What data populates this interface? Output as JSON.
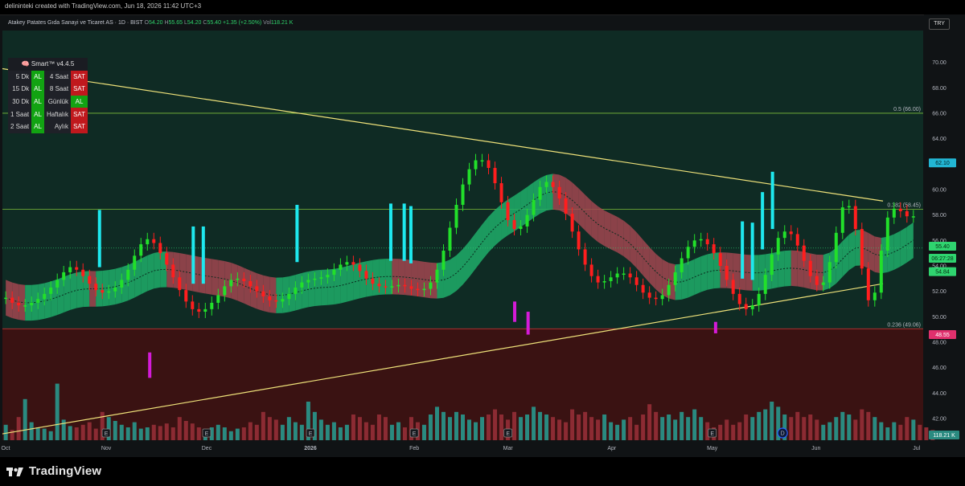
{
  "header": {
    "attribution": "delininteki created with TradingView.com, Jun 18, 2026 11:42 UTC+3"
  },
  "legend": {
    "symbol": "Atakey Patates Gıda Sanayi ve Ticaret AS · 1D · BIST",
    "open_label": "O",
    "open": "54.20",
    "high_label": "H",
    "high": "55.65",
    "low_label": "L",
    "low": "54.20",
    "close_label": "C",
    "close": "55.40",
    "change": "+1.35 (+2.50%)",
    "vol_label": "Vol",
    "vol": "118.21 K"
  },
  "currency": "TRY",
  "indicator_table": {
    "title": "🧠 Smart™ v4.4.5",
    "rows": [
      {
        "tf1": "5 Dk",
        "s1": "AL",
        "tf2": "4 Saat",
        "s2": "SAT"
      },
      {
        "tf1": "15 Dk",
        "s1": "AL",
        "tf2": "8 Saat",
        "s2": "SAT"
      },
      {
        "tf1": "30 Dk",
        "s1": "AL",
        "tf2": "Günlük",
        "s2": "AL"
      },
      {
        "tf1": "1 Saat",
        "s1": "AL",
        "tf2": "Haftalık",
        "s2": "SAT"
      },
      {
        "tf1": "2 Saat",
        "s1": "AL",
        "tf2": "Aylık",
        "s2": "SAT"
      }
    ]
  },
  "colors": {
    "bg_upper": "#0f2b24",
    "bg_lower": "#3a1212",
    "up": "#22e02a",
    "down": "#ff1e1e",
    "spike": "#1ee8ee",
    "magenta": "#d41bd8",
    "trend": "#efe27a",
    "fib": "#7fbf3a",
    "fib_low": "#d43a3a",
    "cloud_up": "#1fae6a",
    "cloud_down": "#a14750",
    "vol_up": "#2a8a80",
    "vol_down": "#8c2b33",
    "accent": "#2962ff"
  },
  "fib_levels": [
    {
      "label": "0.5 (66.00)",
      "value": 66.0
    },
    {
      "label": "0.382 (58.45)",
      "value": 58.45
    },
    {
      "label": "0.236 (49.06)",
      "value": 49.06
    }
  ],
  "price_tags": [
    {
      "text": "62.10",
      "value": 62.1,
      "bg": "#22b6d4",
      "fg": "#001a1a"
    },
    {
      "text": "55.40",
      "value": 55.55,
      "bg": "#2fd46f",
      "fg": "#062b12"
    },
    {
      "text": "06:27:28",
      "value": 54.6,
      "bg": "#2fd46f",
      "fg": "#062b12"
    },
    {
      "text": "54.84",
      "value": 53.55,
      "bg": "#2fd46f",
      "fg": "#062b12"
    },
    {
      "text": "48.55",
      "value": 48.6,
      "bg": "#e0306d",
      "fg": "#ffffff"
    }
  ],
  "volume_tag": "118.21 K",
  "event_marker": "D",
  "earnings_marker": "E",
  "chart_data": {
    "type": "candlestick",
    "y_ticks": [
      "42.00",
      "44.00",
      "46.00",
      "48.00",
      "50.00",
      "52.00",
      "54.00",
      "56.00",
      "58.00",
      "60.00",
      "62.00",
      "64.00",
      "66.00",
      "68.00",
      "70.00"
    ],
    "ylim": [
      40.3,
      72.5
    ],
    "x_ticks": [
      "Oct",
      "Nov",
      "Dec",
      "2026",
      "Feb",
      "Mar",
      "Apr",
      "May",
      "Jun",
      "Jul"
    ],
    "x_tick_days": [
      0,
      31,
      61,
      92,
      123,
      151,
      182,
      212,
      243,
      273
    ],
    "xlim": [
      0,
      275
    ],
    "earnings_days": [
      31,
      61,
      92,
      123,
      151,
      212
    ],
    "trendlines": [
      {
        "start": [
          0,
          69.5
        ],
        "end": [
          263,
          59.1
        ]
      },
      {
        "start": [
          0,
          40.8
        ],
        "end": [
          263,
          52.6
        ]
      }
    ],
    "dashed_reference": 55.4,
    "candle_mid": [
      51.5,
      51.1,
      50.9,
      50.9,
      51.1,
      51.4,
      51.8,
      52.3,
      52.9,
      53.5,
      53.9,
      53.7,
      53.2,
      52.6,
      52.1,
      51.9,
      52.0,
      52.3,
      52.9,
      53.7,
      54.8,
      55.7,
      56.1,
      55.8,
      55.0,
      54.1,
      53.1,
      52.1,
      51.2,
      50.6,
      50.4,
      50.6,
      51.1,
      51.7,
      52.4,
      52.9,
      53.0,
      52.8,
      52.4,
      52.0,
      51.6,
      51.3,
      51.2,
      51.4,
      51.8,
      52.3,
      52.7,
      52.9,
      53.0,
      53.1,
      53.3,
      53.7,
      54.1,
      54.3,
      54.1,
      53.6,
      53.0,
      52.6,
      52.4,
      52.3,
      52.4,
      52.5,
      52.4,
      52.2,
      52.1,
      52.2,
      52.7,
      53.7,
      55.2,
      57.0,
      58.8,
      60.4,
      61.6,
      62.3,
      62.3,
      61.7,
      60.5,
      59.0,
      57.6,
      56.9,
      57.1,
      58.0,
      59.2,
      60.2,
      60.6,
      60.2,
      59.3,
      58.1,
      56.7,
      55.3,
      54.1,
      53.2,
      52.7,
      52.8,
      53.1,
      53.4,
      53.4,
      53.1,
      52.5,
      51.9,
      51.5,
      51.4,
      51.7,
      52.5,
      53.5,
      54.6,
      55.5,
      56.0,
      56.1,
      55.7,
      55.0,
      54.0,
      52.9,
      51.8,
      51.0,
      50.6,
      50.9,
      51.8,
      53.3,
      54.9,
      56.2,
      56.7,
      56.5,
      55.6,
      54.4,
      53.2,
      52.5,
      52.7,
      54.3,
      56.6,
      58.6,
      58.7,
      56.9,
      53.8,
      51.3,
      51.9,
      55.2,
      57.8,
      58.5,
      58.3,
      57.9,
      57.9
    ],
    "spike_highs_days": [
      29,
      57,
      60,
      88,
      116,
      120,
      122,
      221,
      224,
      227,
      230
    ],
    "volume_relative": [
      0.12,
      0.08,
      0.18,
      0.32,
      0.14,
      0.1,
      0.09,
      0.07,
      0.44,
      0.16,
      0.11,
      0.1,
      0.12,
      0.14,
      0.09,
      0.22,
      0.18,
      0.15,
      0.12,
      0.1,
      0.14,
      0.09,
      0.1,
      0.12,
      0.11,
      0.13,
      0.1,
      0.18,
      0.15,
      0.13,
      0.1,
      0.08,
      0.1,
      0.12,
      0.1,
      0.07,
      0.09,
      0.1,
      0.14,
      0.12,
      0.22,
      0.18,
      0.16,
      0.12,
      0.18,
      0.14,
      0.12,
      0.3,
      0.22,
      0.16,
      0.12,
      0.14,
      0.1,
      0.12,
      0.2,
      0.18,
      0.14,
      0.12,
      0.2,
      0.18,
      0.12,
      0.14,
      0.1,
      0.18,
      0.14,
      0.12,
      0.2,
      0.26,
      0.22,
      0.18,
      0.22,
      0.2,
      0.16,
      0.14,
      0.18,
      0.2,
      0.24,
      0.2,
      0.16,
      0.22,
      0.18,
      0.2,
      0.26,
      0.22,
      0.2,
      0.18,
      0.16,
      0.14,
      0.24,
      0.2,
      0.22,
      0.18,
      0.16,
      0.2,
      0.14,
      0.12,
      0.16,
      0.18,
      0.12,
      0.2,
      0.28,
      0.22,
      0.18,
      0.2,
      0.16,
      0.22,
      0.18,
      0.24,
      0.18,
      0.14,
      0.1,
      0.12,
      0.16,
      0.12,
      0.14,
      0.2,
      0.18,
      0.22,
      0.24,
      0.3,
      0.26,
      0.2,
      0.18,
      0.22,
      0.18,
      0.2,
      0.16,
      0.12,
      0.14,
      0.18,
      0.22,
      0.2,
      0.16,
      0.24,
      0.22,
      0.18,
      0.14,
      0.1,
      0.14,
      0.12,
      0.18,
      0.16,
      0.12,
      0.1,
      0.08
    ]
  }
}
